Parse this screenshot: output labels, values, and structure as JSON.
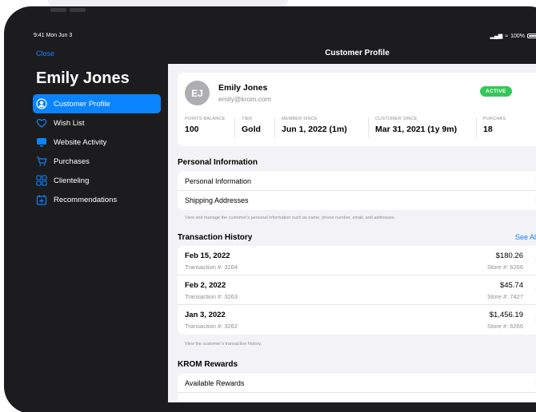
{
  "status_bar": {
    "time": "9:41  Mon Jun 3",
    "battery": "100%"
  },
  "sidebar": {
    "close_label": "Close",
    "customer_name": "Emily Jones",
    "items": [
      {
        "label": "Customer Profile",
        "icon": "person-circle-icon",
        "active": true
      },
      {
        "label": "Wish List",
        "icon": "heart-icon",
        "active": false
      },
      {
        "label": "Website Activity",
        "icon": "desktop-icon",
        "active": false
      },
      {
        "label": "Purchases",
        "icon": "cart-icon",
        "active": false
      },
      {
        "label": "Clienteling",
        "icon": "grid-icon",
        "active": false
      },
      {
        "label": "Recommendations",
        "icon": "gift-box-icon",
        "active": false
      }
    ]
  },
  "header": {
    "title": "Customer Profile"
  },
  "profile": {
    "initials": "EJ",
    "name": "Emily Jones",
    "email": "emily@krom.com",
    "status_badge": "ACTIVE",
    "metrics": [
      {
        "label": "POINTS BALANCE",
        "value": "100"
      },
      {
        "label": "TIER",
        "value": "Gold"
      },
      {
        "label": "MEMBER SINCE",
        "value": "Jun 1, 2022 (1m)"
      },
      {
        "label": "CUSTOMER SINCE",
        "value": "Mar 31, 2021 (1y 9m)"
      },
      {
        "label": "PURCHAS",
        "value": "18"
      }
    ]
  },
  "personal_info": {
    "title": "Personal Information",
    "rows": [
      "Personal Information",
      "Shipping Addresses"
    ],
    "footnote": "View and manage the customer's personal information such as name, phone number, email, and addresses."
  },
  "transactions": {
    "title": "Transaction History",
    "see_all": "See All",
    "rows": [
      {
        "date": "Feb 15, 2022",
        "number": "Transaction #: 3264",
        "amount": "$180.26",
        "store": "Store #: 6266"
      },
      {
        "date": "Feb 2, 2022",
        "number": "Transaction #: 3263",
        "amount": "$45.74",
        "store": "Store #: 7427"
      },
      {
        "date": "Jan 3, 2022",
        "number": "Transaction #: 3262",
        "amount": "$1,456.19",
        "store": "Store #: 6266"
      }
    ],
    "footnote": "View the customer's transaction history."
  },
  "rewards": {
    "title": "KROM Rewards",
    "rows": [
      "Available Rewards"
    ]
  },
  "colors": {
    "accent": "#0a84ff",
    "active_badge": "#34c759",
    "sidebar_bg": "#1c1c1e",
    "content_bg": "#f2f2f7"
  }
}
